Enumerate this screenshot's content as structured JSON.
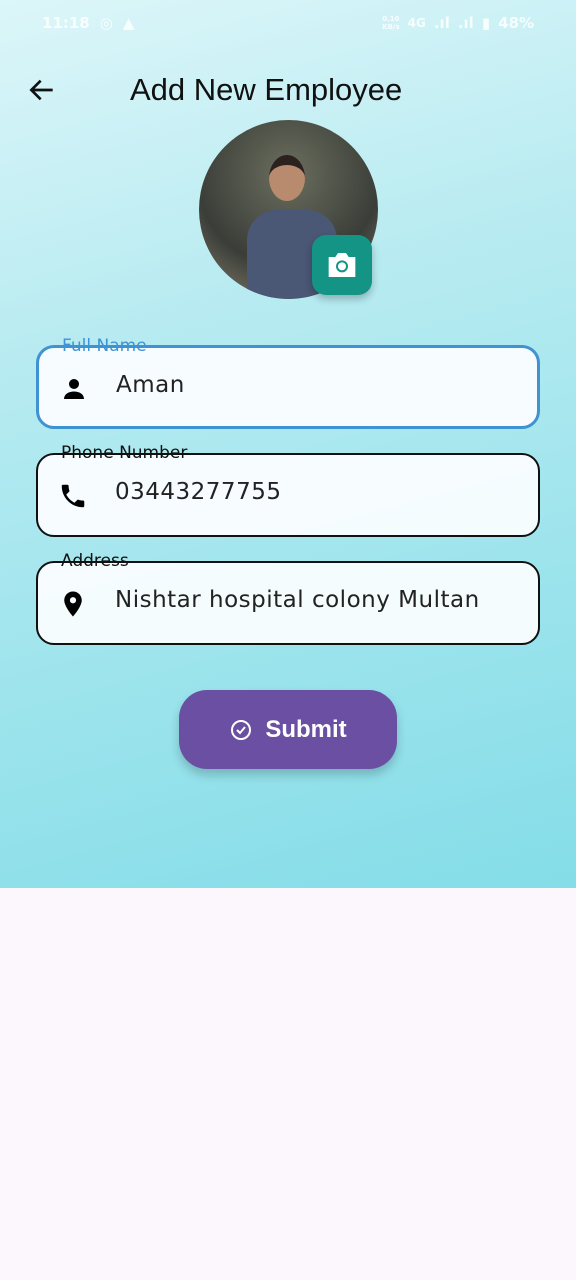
{
  "status_bar": {
    "time": "11:18",
    "speed": "0.10\nKB/s",
    "network": "4G",
    "battery": "48%"
  },
  "header": {
    "title": "Add New Employee"
  },
  "form": {
    "full_name": {
      "label": "Full Name",
      "value": "Aman"
    },
    "phone": {
      "label": "Phone Number",
      "value": "03443277755"
    },
    "address": {
      "label": "Address",
      "value": "Nishtar hospital colony Multan"
    }
  },
  "submit_label": "Submit",
  "colors": {
    "accent": "#6a4fa3",
    "camera": "#139485",
    "focus": "#3f93d2"
  }
}
